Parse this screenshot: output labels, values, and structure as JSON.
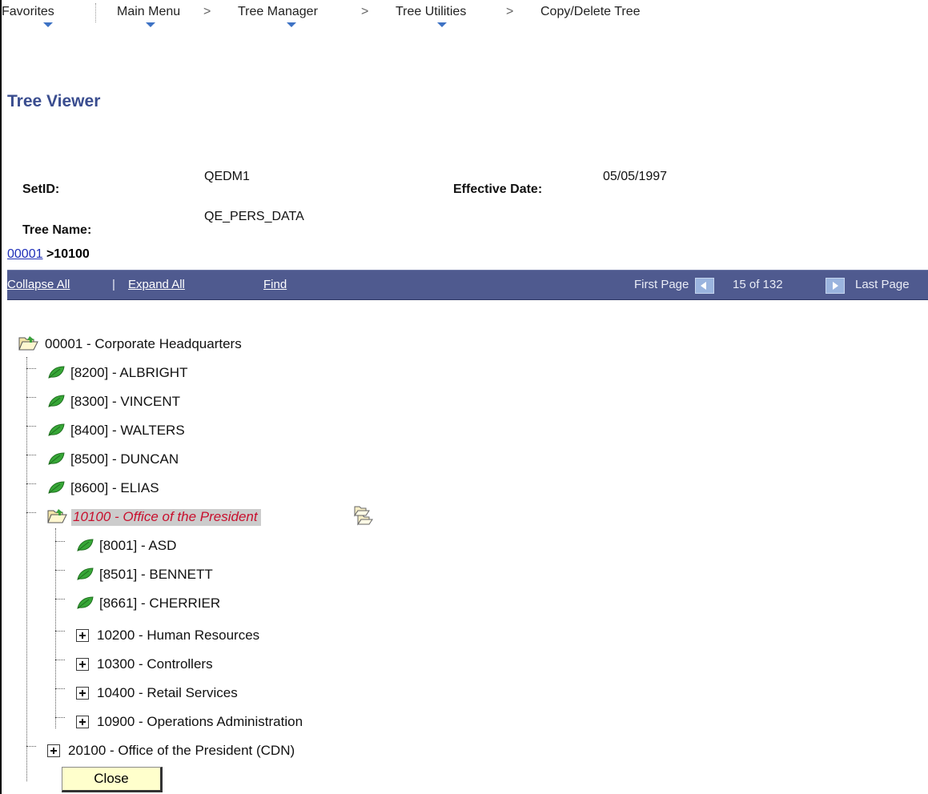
{
  "nav": {
    "favorites": "Favorites",
    "main_menu": "Main Menu",
    "tree_manager": "Tree Manager",
    "tree_utilities": "Tree Utilities",
    "current": "Copy/Delete Tree",
    "separator": ">"
  },
  "page": {
    "title": "Tree Viewer"
  },
  "fields": {
    "setid_label": "SetID:",
    "setid_value": "QEDM1",
    "effdate_label": "Effective Date:",
    "effdate_value": "05/05/1997",
    "treename_label": "Tree Name:",
    "treename_value": "QE_PERS_DATA"
  },
  "breadcrumb": {
    "root_link": "00001",
    "current": ">10100"
  },
  "toolbar": {
    "collapse_all": "Collapse All",
    "separator": "|",
    "expand_all": "Expand All",
    "find": "Find",
    "first_page": "First Page",
    "page_status": "15 of 132",
    "last_page": "Last Page"
  },
  "tree": {
    "root": "00001 - Corporate Headquarters",
    "children": [
      "[8200] - ALBRIGHT",
      "[8300] - VINCENT",
      "[8400] - WALTERS",
      "[8500] - DUNCAN",
      "[8600] - ELIAS"
    ],
    "selected": "10100 - Office of the President",
    "selected_children_leaves": [
      "[8001] - ASD",
      "[8501] - BENNETT",
      "[8661] - CHERRIER"
    ],
    "selected_children_nodes": [
      "10200 - Human Resources",
      "10300 - Controllers",
      "10400 - Retail Services",
      "10900 - Operations Administration"
    ],
    "sibling_node": "20100 - Office of the President (CDN)"
  },
  "buttons": {
    "close": "Close"
  },
  "colors": {
    "title": "#3a4d8f",
    "toolbar_band": "#4f5a8f",
    "selected_text": "#c8102e",
    "leaf_green": "#2fa02f",
    "close_button_bg": "#ffffcc"
  },
  "icons": {
    "leaf": "leaf-icon",
    "open_folder": "open-folder-icon",
    "expand": "plus-box-icon",
    "insert_child": "insert-child-folder-icon"
  }
}
